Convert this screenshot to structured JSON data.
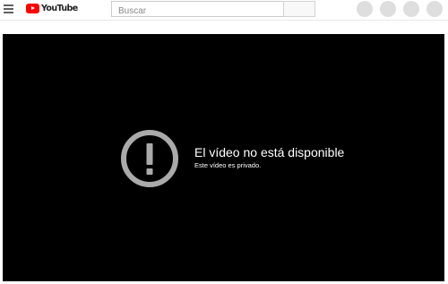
{
  "header": {
    "menu_icon": "hamburger-menu-icon",
    "logo": {
      "icon": "youtube-play-icon",
      "text": "YouTube",
      "brand_color": "#ff0000"
    },
    "search": {
      "placeholder": "Buscar",
      "value": ""
    },
    "search_button_icon": "search-icon",
    "action_buttons": [
      "placeholder",
      "placeholder",
      "placeholder",
      "placeholder"
    ]
  },
  "player": {
    "background_color": "#000000",
    "icon": "alert-circle-icon",
    "icon_color": "#aaaaaa",
    "title": "El vídeo no está disponible",
    "subtitle": "Este vídeo es privado."
  }
}
